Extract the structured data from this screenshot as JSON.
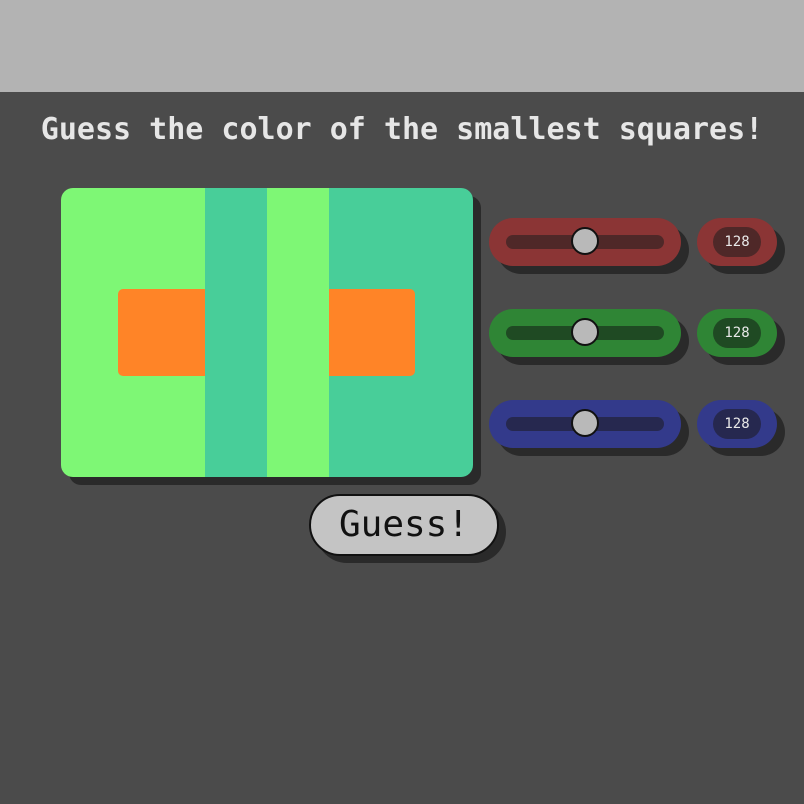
{
  "header": {
    "title": "Guess the color of the smallest squares!"
  },
  "puzzle": {
    "colors": {
      "light_green": "#7ef775",
      "teal": "#48ce99",
      "orange": "#ff8427"
    }
  },
  "sliders": [
    {
      "channel": "red",
      "value": 128,
      "min": 0,
      "max": 255,
      "body_color": "#8b3535",
      "track_color": "#4f2828",
      "value_display": "128"
    },
    {
      "channel": "green",
      "value": 128,
      "min": 0,
      "max": 255,
      "body_color": "#2f8535",
      "track_color": "#1f4a23",
      "value_display": "128"
    },
    {
      "channel": "blue",
      "value": 128,
      "min": 0,
      "max": 255,
      "body_color": "#333a8b",
      "track_color": "#26284f",
      "value_display": "128"
    }
  ],
  "actions": {
    "guess_label": "Guess!"
  }
}
